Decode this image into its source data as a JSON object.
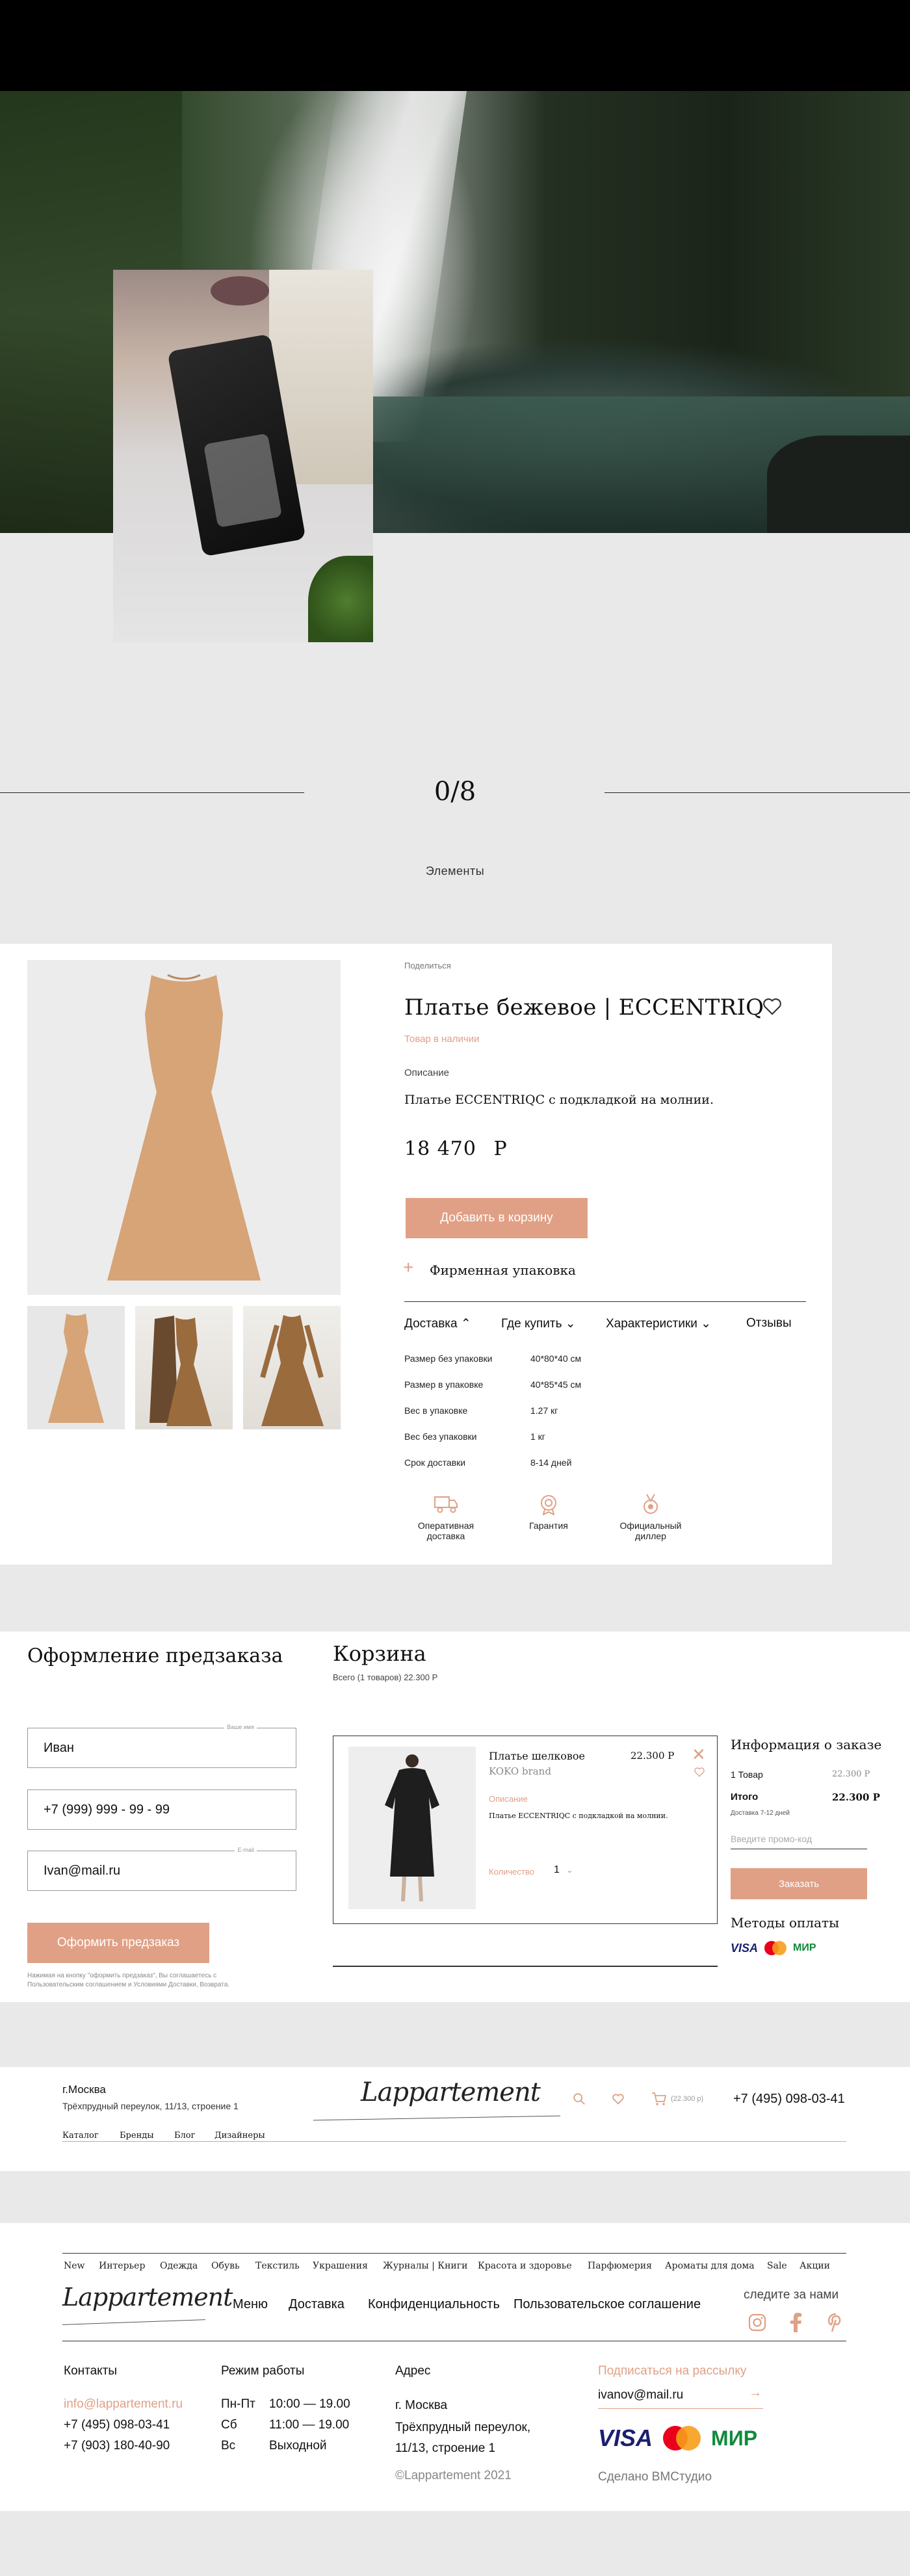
{
  "hero": {},
  "counter": {
    "text": "0/8"
  },
  "section": {
    "label": "Элементы"
  },
  "product": {
    "share": "Поделиться",
    "title": "Платье бежевое | ECCENTRIQ",
    "stock": "Товар в наличии",
    "description_label": "Описание",
    "description": "Платье ECCENTRIQC с подкладкой на молнии.",
    "price": "18 470",
    "currency": "Р",
    "add_to_cart": "Добавить в корзину",
    "packaging": "Фирменная упаковка",
    "tabs": [
      "Доставка",
      "Где купить",
      "Характеристики",
      "Отзывы"
    ],
    "specs": [
      {
        "label": "Размер без упаковки",
        "value": "40*80*40 см"
      },
      {
        "label": "Размер в упаковке",
        "value": "40*85*45 см"
      },
      {
        "label": "Вес в упаковке",
        "value": "1.27 кг"
      },
      {
        "label": "Вес без упаковки",
        "value": "1 кг"
      },
      {
        "label": "Срок доставки",
        "value": "8-14 дней"
      }
    ],
    "features": [
      {
        "icon": "truck-icon",
        "label_1": "Оперативная",
        "label_2": "доставка"
      },
      {
        "icon": "warranty-icon",
        "label_1": "Гарантия",
        "label_2": ""
      },
      {
        "icon": "medal-icon",
        "label_1": "Официальный",
        "label_2": "диллер"
      }
    ]
  },
  "checkout": {
    "title": "Оформление предзаказа",
    "name_value": "Иван",
    "name_label": "Ваше имя",
    "phone_value": "+7 (999) 999 - 99 - 99",
    "email_value": "Ivan@mail.ru",
    "email_label": "E-mail",
    "submit": "Оформить предзаказ",
    "fine_1": "Нажимая на кнопку \"оформить предзаказ\", Вы соглашаетесь с",
    "fine_2": "Пользовательским соглашением и Условиями Доставки, Возврата."
  },
  "cart": {
    "title": "Корзина",
    "subtitle": "Всего (1 товаров)   22.300 Р",
    "item": {
      "name": "Платье шелковое",
      "brand": "KOKO brand",
      "price": "22.300 Р",
      "desc_label": "Описание",
      "desc": "Платье ECCENTRIQC с подкладкой на молнии.",
      "qty_label": "Количество",
      "qty": "1"
    }
  },
  "order_info": {
    "title": "Информация о заказе",
    "goods_label": "1 Товар",
    "goods_value": "22.300 Р",
    "total_label": "Итого",
    "total_value": "22.300 Р",
    "delivery": "Доставка 7-12 дней",
    "promo_placeholder": "Введите промо-код",
    "order_button": "Заказать",
    "pay_title": "Методы оплаты",
    "pay_methods": [
      "VISA",
      "MasterCard",
      "МИР"
    ]
  },
  "header": {
    "city": "г.Москва",
    "address": "Трёхпрудный переулок, 11/13, строение 1",
    "nav": [
      "Каталог",
      "Бренды",
      "Блог",
      "Дизайнеры"
    ],
    "logo": "Lappartement",
    "cart_total": "(22.300 р)",
    "phone": "+7 (495) 098-03-41"
  },
  "footer": {
    "categories": [
      "New",
      "Интерьер",
      "Одежда",
      "Обувь",
      "Текстиль",
      "Украшения",
      "Журналы | Книги",
      "Красота и здоровье",
      "Парфюмерия",
      "Ароматы для дома",
      "Sale",
      "Акции"
    ],
    "logo": "Lappartement",
    "nav": [
      "Меню",
      "Доставка",
      "Конфиденциальность",
      "Пользовательское соглашение"
    ],
    "follow": "следите за нами",
    "contacts_title": "Контакты",
    "email": "info@lappartement.ru",
    "phone_1": "+7 (495) 098-03-41",
    "phone_2": "+7 (903) 180-40-90",
    "hours_title": "Режим работы",
    "hours": [
      {
        "day": "Пн-Пт",
        "time": "10:00 — 19.00"
      },
      {
        "day": "Сб",
        "time": "11:00 — 19.00"
      },
      {
        "day": "Вс",
        "time": "Выходной"
      }
    ],
    "address_title": "Адрес",
    "address_1": "г. Москва",
    "address_2": "Трёхпрудный переулок,",
    "address_3": "11/13, строение 1",
    "copyright": "©Lappartement 2021",
    "subscribe_title": "Подписаться на рассылку",
    "subscribe_value": "ivanov@mail.ru",
    "made_by": "Сделано BMCтудио"
  },
  "colors": {
    "accent": "#e0a085",
    "background": "#e9e9e9",
    "text": "#111111"
  }
}
